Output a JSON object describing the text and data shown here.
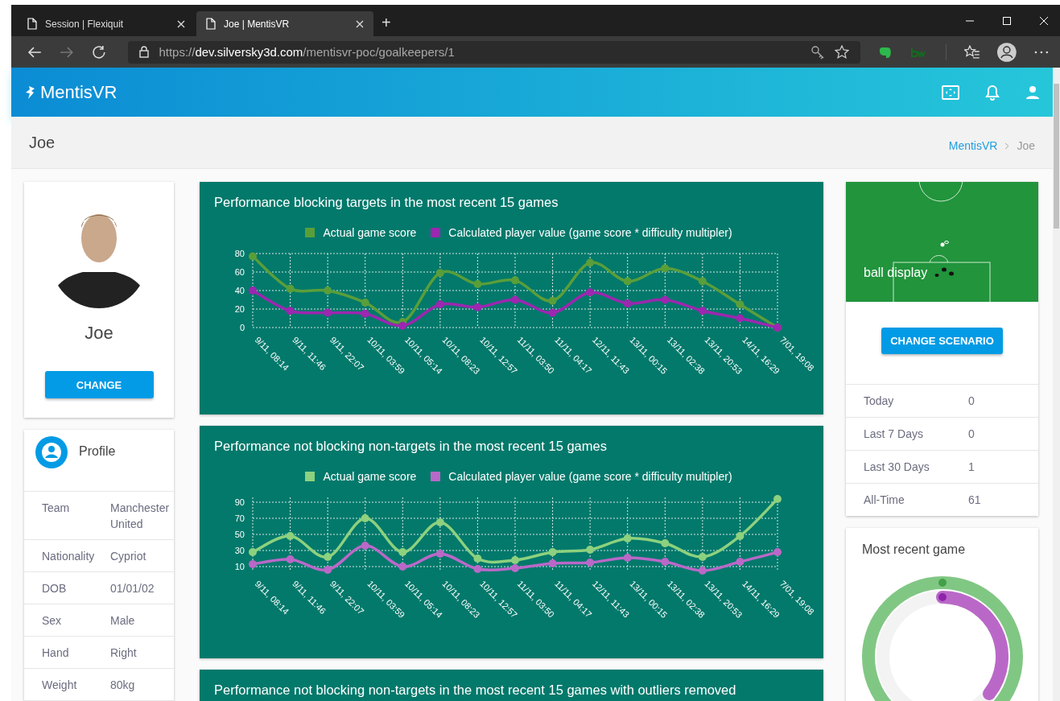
{
  "browser": {
    "tabs": [
      {
        "title": "Session | Flexiquit",
        "selected": false
      },
      {
        "title": "Joe | MentisVR",
        "selected": true
      }
    ],
    "new_tab": "+",
    "address": {
      "scheme": "https://",
      "host": "dev.silversky3d.com",
      "path": "/mentisvr-poc/goalkeepers/1"
    }
  },
  "app": {
    "brand": "MentisVR"
  },
  "page_header": {
    "title": "Joe",
    "breadcrumb": [
      "MentisVR",
      "Joe"
    ]
  },
  "player_card": {
    "name": "Joe",
    "button": "CHANGE"
  },
  "profile": {
    "title": "Profile",
    "rows": [
      {
        "label": "Team",
        "value": "Manchester United"
      },
      {
        "label": "Nationality",
        "value": "Cypriot"
      },
      {
        "label": "DOB",
        "value": "01/01/02"
      },
      {
        "label": "Sex",
        "value": "Male"
      },
      {
        "label": "Hand",
        "value": "Right"
      },
      {
        "label": "Weight",
        "value": "80kg"
      }
    ]
  },
  "cards": [
    {
      "title": "Performance blocking targets in the most recent 15 games",
      "chart_data": {
        "type": "line",
        "categories": [
          "9/11, 08:14",
          "9/11, 11:46",
          "9/11, 22:07",
          "10/11, 03:59",
          "10/11, 05:14",
          "10/11, 08:23",
          "10/11, 12:57",
          "11/11, 03:50",
          "11/11, 04:17",
          "12/11, 11:43",
          "13/11, 00:15",
          "13/11, 02:38",
          "13/11, 20:53",
          "14/11, 16:29",
          "7/01, 19:08"
        ],
        "ylim": [
          0,
          80
        ],
        "yticks": [
          0,
          20,
          40,
          60,
          80
        ],
        "grid": true,
        "series": [
          {
            "name": "Actual game score",
            "color": "#5a9e3a",
            "marker": true,
            "values": [
              77,
              42,
              40,
              27,
              6,
              59,
              47,
              51,
              29,
              70,
              50,
              64,
              50,
              25,
              0
            ]
          },
          {
            "name": "Calculated player value (game score * difficulty multipler)",
            "color": "#9c27b0",
            "marker": true,
            "values": [
              40,
              18,
              16,
              15,
              2,
              25,
              22,
              30,
              16,
              38,
              26,
              30,
              18,
              10,
              0
            ]
          }
        ]
      }
    },
    {
      "title": "Performance not blocking non-targets in the most recent 15 games",
      "chart_data": {
        "type": "line",
        "categories": [
          "9/11, 08:14",
          "9/11, 11:46",
          "9/11, 22:07",
          "10/11, 03:59",
          "10/11, 05:14",
          "10/11, 08:23",
          "10/11, 12:57",
          "11/11, 03:50",
          "11/11, 04:17",
          "12/11, 11:43",
          "13/11, 00:15",
          "13/11, 02:38",
          "13/11, 20:53",
          "14/11, 16:29",
          "7/01, 19:08"
        ],
        "ylim": [
          4,
          96
        ],
        "yticks": [
          10,
          30,
          50,
          70,
          90
        ],
        "grid": true,
        "series": [
          {
            "name": "Actual game score",
            "color": "#8dd17e",
            "marker": true,
            "values": [
              28,
              48,
              22,
              70,
              28,
              65,
              20,
              18,
              28,
              31,
              45,
              39,
              22,
              48,
              94
            ]
          },
          {
            "name": "Calculated player value (game score * difficulty multipler)",
            "color": "#ba68c8",
            "marker": true,
            "values": [
              13,
              19,
              6,
              36,
              10,
              26,
              7,
              8,
              14,
              15,
              21,
              16,
              5,
              16,
              28
            ]
          }
        ]
      }
    },
    {
      "title": "Performance not blocking non-targets in the most recent 15 games with outliers removed"
    }
  ],
  "ball_display": {
    "label": "ball display",
    "button": "CHANGE SCENARIO"
  },
  "stats": [
    {
      "label": "Today",
      "value": "0"
    },
    {
      "label": "Last 7 Days",
      "value": "0"
    },
    {
      "label": "Last 30 Days",
      "value": "1"
    },
    {
      "label": "All-Time",
      "value": "61"
    }
  ],
  "recent_game": {
    "title": "Most recent game"
  }
}
